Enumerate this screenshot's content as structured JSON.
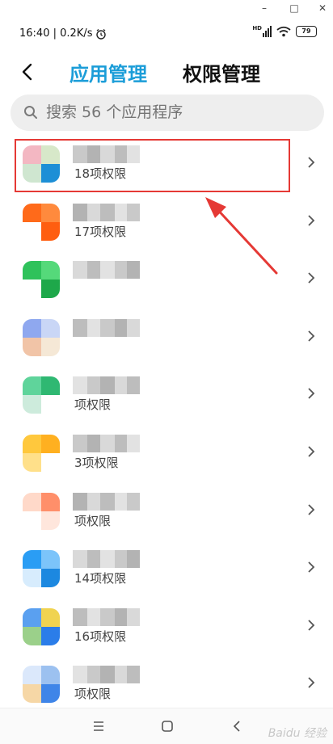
{
  "window": {
    "min_glyph": "–",
    "max_glyph": "□",
    "close_glyph": "✕"
  },
  "status": {
    "time_speed": "16:40 | 0.2K/s",
    "hd": "HD",
    "battery": "79"
  },
  "tabs": {
    "active": "应用管理",
    "inactive": "权限管理"
  },
  "search": {
    "placeholder": "搜索 56 个应用程序"
  },
  "apps": [
    {
      "perm": "18项权限",
      "icon_colors": [
        "#f3b7c2",
        "#d7e8c9",
        "#cfe6d0",
        "#1d8fd6"
      ]
    },
    {
      "perm": "17项权限",
      "icon_colors": [
        "#ff6a1a",
        "#ff8a3d",
        "#ffffff",
        "#ff5e10"
      ]
    },
    {
      "perm": "",
      "icon_colors": [
        "#2fc25b",
        "#55d97a",
        "#ffffff",
        "#1ea84a"
      ]
    },
    {
      "perm": "",
      "icon_colors": [
        "#8fa8ef",
        "#c9d6f6",
        "#f1c4a7",
        "#f5e8d6"
      ]
    },
    {
      "perm": "项权限",
      "icon_colors": [
        "#5fd49b",
        "#2fb872",
        "#cdebdc",
        "#ffffff"
      ]
    },
    {
      "perm": "3项权限",
      "icon_colors": [
        "#ffc83d",
        "#ffb020",
        "#ffe08a",
        "#ffffff"
      ]
    },
    {
      "perm": "项权限",
      "icon_colors": [
        "#ffd9c9",
        "#ff8f6a",
        "#ffffff",
        "#ffe6dc"
      ]
    },
    {
      "perm": "14项权限",
      "icon_colors": [
        "#2a9df4",
        "#7cc4fa",
        "#d7ecfd",
        "#1c88e0"
      ]
    },
    {
      "perm": "16项权限",
      "icon_colors": [
        "#5aa0f0",
        "#f0d350",
        "#9bd08a",
        "#2b7de9"
      ]
    },
    {
      "perm": "项权限",
      "icon_colors": [
        "#dbe8fb",
        "#9cc1f0",
        "#f6d7a6",
        "#3f85e8"
      ]
    }
  ],
  "watermark": "Baidu 经验"
}
